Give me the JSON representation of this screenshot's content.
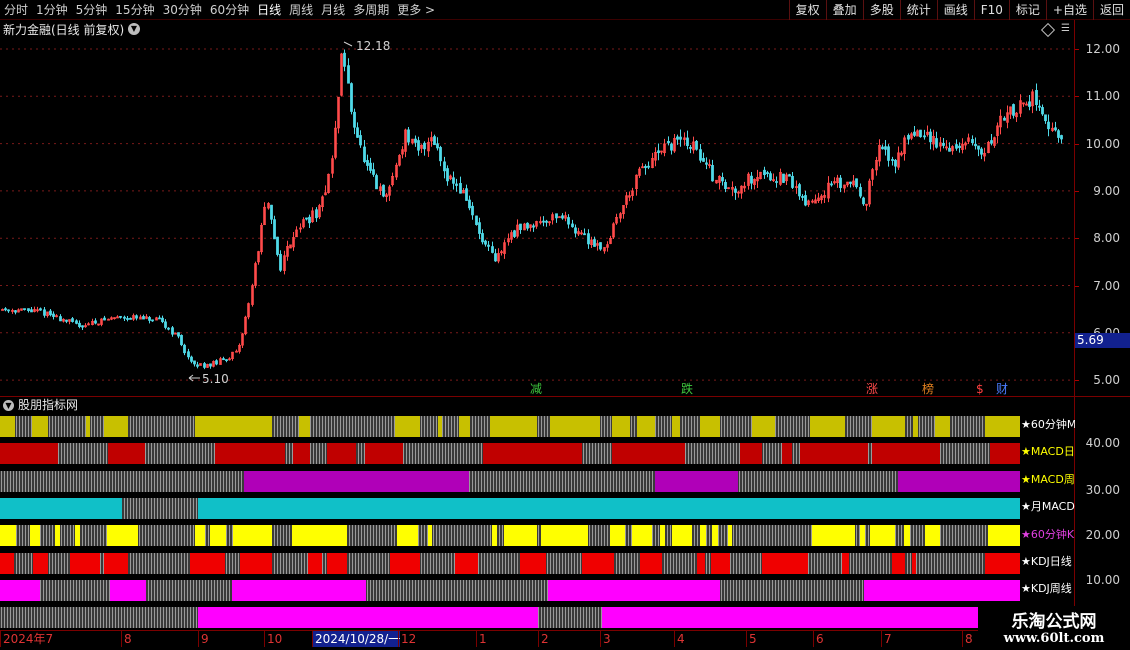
{
  "toolbar": {
    "periods": [
      {
        "label": "分时"
      },
      {
        "label": "1分钟"
      },
      {
        "label": "5分钟"
      },
      {
        "label": "15分钟"
      },
      {
        "label": "30分钟"
      },
      {
        "label": "60分钟"
      },
      {
        "label": "日线",
        "active": true
      },
      {
        "label": "周线"
      },
      {
        "label": "月线"
      },
      {
        "label": "多周期"
      },
      {
        "label": "更多 >"
      }
    ],
    "tools": [
      {
        "label": "复权"
      },
      {
        "label": "叠加"
      },
      {
        "label": "多股"
      },
      {
        "label": "统计"
      },
      {
        "label": "画线"
      },
      {
        "label": "F10"
      },
      {
        "label": "标记"
      },
      {
        "label": "+自选"
      },
      {
        "label": "返回"
      }
    ]
  },
  "main_chart": {
    "title": "新力金融(日线 前复权)",
    "high_label": "12.18",
    "low_label": "5.10",
    "current_price": "5.69",
    "y_ticks": [
      "12.00",
      "11.00",
      "10.00",
      "9.00",
      "8.00",
      "7.00",
      "6.00",
      "5.00"
    ],
    "y_range": [
      4.8,
      12.6
    ],
    "up_color": "#ff4a4a",
    "down_color": "#4fd9e8",
    "event_markers": [
      {
        "label": "减",
        "color": "#3ec83e"
      },
      {
        "label": "跌",
        "color": "#3ec83e"
      },
      {
        "label": "涨",
        "color": "#ff4a4a"
      },
      {
        "label": "榜",
        "color": "#e08020"
      },
      {
        "label": "$",
        "color": "#ff4040"
      },
      {
        "label": "财",
        "color": "#4a7cff"
      }
    ]
  },
  "indicator": {
    "title": "股朋指标网",
    "y_ticks": [
      "40.00",
      "30.00",
      "20.00",
      "10.00"
    ],
    "rows": [
      {
        "label": "★60分钟M",
        "label_color": "#ffffff",
        "color": "#c8c000"
      },
      {
        "label": "★MACD日",
        "label_color": "#ffff00",
        "color": "#c00000"
      },
      {
        "label": "★MACD周",
        "label_color": "#ffff00",
        "color": "#b000b8"
      },
      {
        "label": "★月MACD",
        "label_color": "#ffffff",
        "color": "#10c0c8"
      },
      {
        "label": "★60分钟K",
        "label_color": "#e040e0",
        "color": "#ffff00"
      },
      {
        "label": "★KDJ日线",
        "label_color": "#ffffff",
        "color": "#f00000"
      },
      {
        "label": "★KDJ周线",
        "label_color": "#ffffff",
        "color": "#ff00ff"
      },
      {
        "label": "",
        "label_color": "#ffffff",
        "color": "#ff00ff"
      }
    ]
  },
  "date_axis": [
    {
      "label": "2024年7"
    },
    {
      "label": "8"
    },
    {
      "label": "9"
    },
    {
      "label": "10"
    },
    {
      "label": "2024/10/28/一",
      "selected": true
    },
    {
      "label": "12"
    },
    {
      "label": "1"
    },
    {
      "label": "2"
    },
    {
      "label": "3"
    },
    {
      "label": "4"
    },
    {
      "label": "5"
    },
    {
      "label": "6"
    },
    {
      "label": "7"
    },
    {
      "label": "8"
    }
  ],
  "watermark": {
    "title": "乐淘公式网",
    "url": "www.60lt.com"
  }
}
